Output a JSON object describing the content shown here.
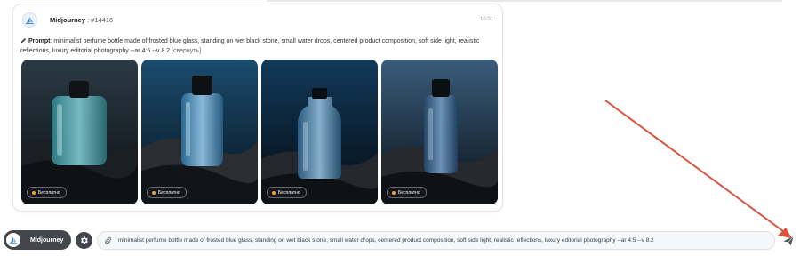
{
  "message": {
    "bot_name": "Midjourney",
    "bot_id": ": #14416",
    "time": "10:01",
    "prompt_label": "Prompt",
    "prompt_text": ": minimalist perfume bottle made of frosted blue glass, standing on wet black stone, small water drops, centered product composition, soft side light, realistic reflections, luxury editorial photography --ar 4:5 --v 8.2",
    "collapse_label": "[свернуть]",
    "images": [
      {
        "badge": "Бесплатно"
      },
      {
        "badge": "Бесплатно"
      },
      {
        "badge": "Бесплатно"
      },
      {
        "badge": "Бесплатно"
      }
    ]
  },
  "composer": {
    "model_name": "Midjourney",
    "input_value": "minimalist perfume bottle made of frosted blue glass, standing on wet black stone, small water drops, centered product composition, soft side light, realistic reflections, luxury editorial photography --ar 4:5 --v 8.2"
  },
  "colors": {
    "annotation_arrow": "#d9533f",
    "badge_dot": "#f4a21d",
    "pill_bg": "#43474d"
  },
  "icons": {
    "bot_avatar": "midjourney-sail-icon",
    "prompt": "pencil-icon",
    "settings": "gear-icon",
    "attach": "paperclip-icon",
    "send": "send-plane-icon"
  }
}
